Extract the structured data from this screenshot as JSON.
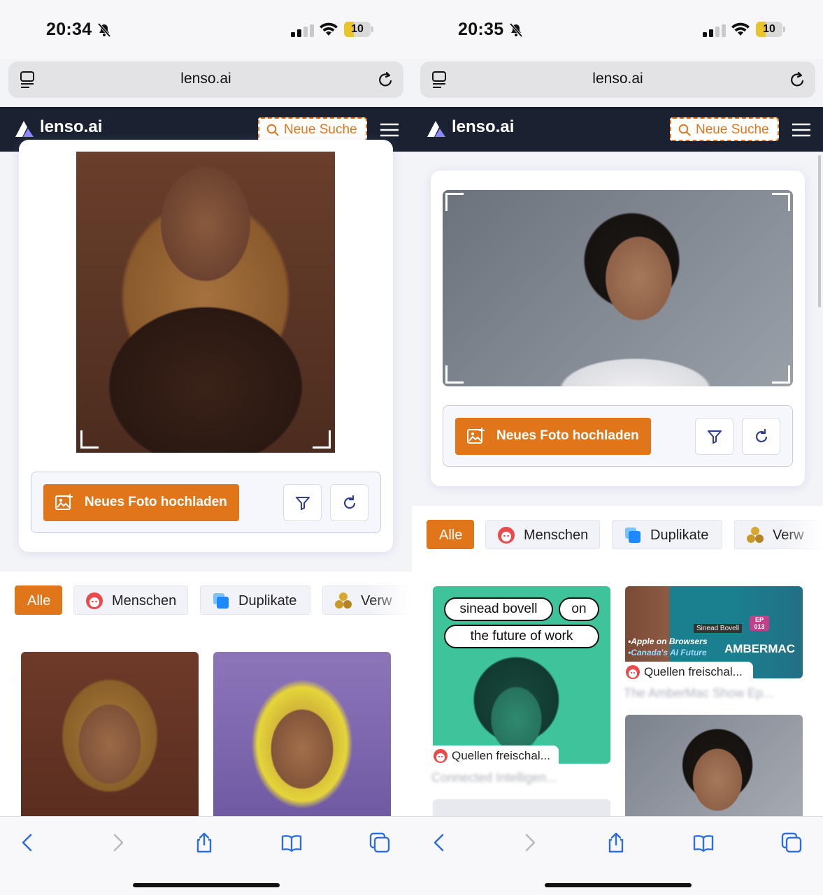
{
  "left": {
    "status": {
      "time": "20:34",
      "battery": "10"
    },
    "url": "lenso.ai",
    "brand": "lenso.ai",
    "new_search": "Neue Suche",
    "upload_label": "Neues Foto hochladen",
    "chips": [
      "Alle",
      "Menschen",
      "Duplikate",
      "Verw"
    ]
  },
  "right": {
    "status": {
      "time": "20:35",
      "battery": "10"
    },
    "url": "lenso.ai",
    "brand": "lenso.ai",
    "new_search": "Neue Suche",
    "upload_label": "Neues Foto hochladen",
    "chips": [
      "Alle",
      "Menschen",
      "Duplikate",
      "Verw"
    ],
    "result1": {
      "tag1": "sinead bovell",
      "tag2": "on",
      "tag3": "the future of work",
      "source": "Quellen freischal...",
      "caption": "Connected Intelligen..."
    },
    "result2": {
      "name_plate": "Sinead Bovell",
      "ep": "EP 013",
      "line1": "•Apple on Browsers",
      "line2": "•Canada's AI Future",
      "show": "AMBERMAC",
      "source": "Quellen freischal...",
      "caption": "The AmberMac Show Ep..."
    }
  },
  "colors": {
    "accent": "#e07519",
    "navbar": "#1a2232",
    "battery": "#e8c52a"
  },
  "icons": [
    "bell-slash-icon",
    "signal-icon",
    "wifi-icon",
    "battery-icon",
    "tabs-icon",
    "reload-icon",
    "logo-icon",
    "search-icon",
    "menu-icon",
    "image-add-icon",
    "filter-icon",
    "refresh-icon",
    "person-face-icon",
    "duplicate-icon",
    "similar-icon",
    "back-icon",
    "forward-icon",
    "share-icon",
    "bookmarks-icon",
    "tab-overview-icon"
  ]
}
